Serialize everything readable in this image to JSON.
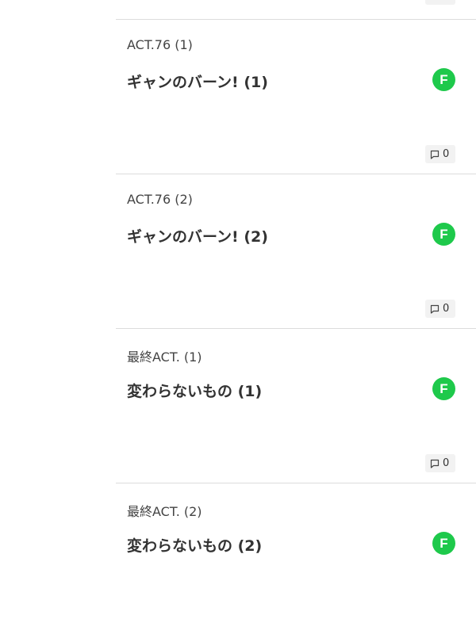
{
  "episodes": [
    {
      "label": "ACT.76 (1)",
      "title": "ギャンのバーン! (1)",
      "badge": "F",
      "comments": "0",
      "badge_color": "#1ec94b"
    },
    {
      "label": "ACT.76 (2)",
      "title": "ギャンのバーン! (2)",
      "badge": "F",
      "comments": "0",
      "badge_color": "#1ec94b"
    },
    {
      "label": "最終ACT. (1)",
      "title": "変わらないもの (1)",
      "badge": "F",
      "comments": "0",
      "badge_color": "#1ec94b"
    },
    {
      "label": "最終ACT. (2)",
      "title": "変わらないもの (2)",
      "badge": "F",
      "comments": "",
      "badge_color": "#1ec94b"
    }
  ],
  "icons": {
    "comment": "comment-icon"
  }
}
